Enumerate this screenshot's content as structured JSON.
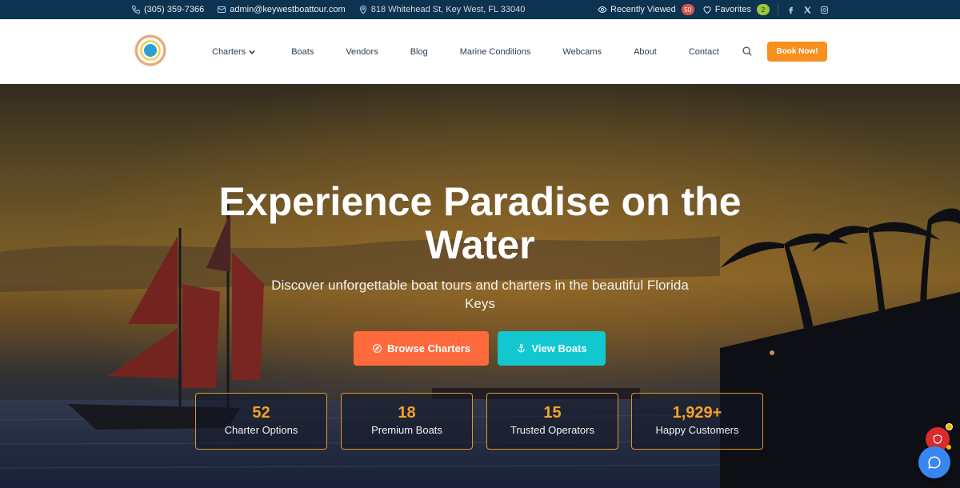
{
  "topbar": {
    "phone": "(305) 359-7366",
    "email": "admin@keywestboattour.com",
    "address": "818 Whitehead St, Key West, FL 33040",
    "recently_viewed_label": "Recently Viewed",
    "recently_viewed_count": "50",
    "favorites_label": "Favorites",
    "favorites_count": "2",
    "social_icons": [
      "facebook-icon",
      "x-icon",
      "instagram-icon"
    ]
  },
  "header": {
    "logo_icon": "key-west-boat-tour-logo",
    "nav": [
      "Charters",
      "Boats",
      "Vendors",
      "Blog",
      "Marine Conditions",
      "Webcams",
      "About",
      "Contact"
    ],
    "book_label": "Book Now!",
    "accent_color": "#f7901e"
  },
  "hero": {
    "title": "Experience Paradise on the Water",
    "subtitle": "Discover unforgettable boat tours and charters in the beautiful Florida Keys",
    "primary_button": "Browse Charters",
    "secondary_button": "View Boats",
    "primary_color": "#ff6a3d",
    "secondary_color": "#12c7cf",
    "stats": [
      {
        "value": "52",
        "label": "Charter Options"
      },
      {
        "value": "18",
        "label": "Premium Boats"
      },
      {
        "value": "15",
        "label": "Trusted Operators"
      },
      {
        "value": "1,929+",
        "label": "Happy Customers"
      }
    ]
  },
  "widgets": {
    "shield_icon": "shield-icon",
    "chat_icon": "chat-icon"
  }
}
